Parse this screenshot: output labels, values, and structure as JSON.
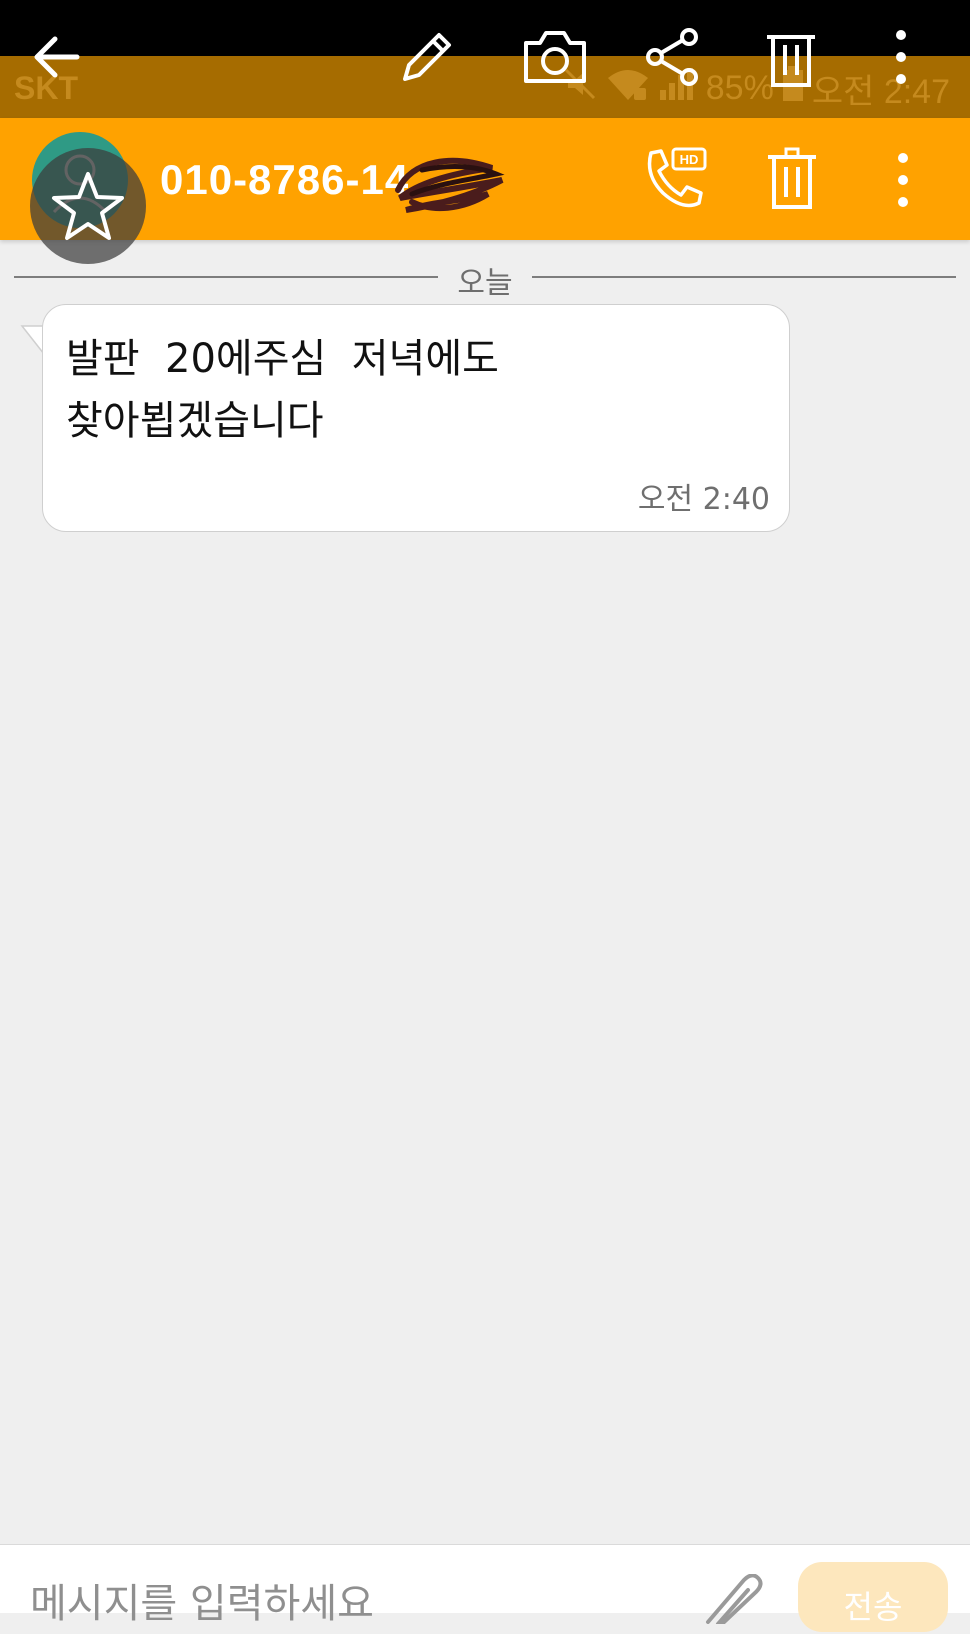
{
  "status_bar": {
    "carrier": "SKT",
    "battery": "85%",
    "time": "오전 2:47",
    "icons": [
      "mute-icon",
      "wifi-icon",
      "signal-icon",
      "battery-icon"
    ]
  },
  "edit_toolbar": {
    "icons": [
      "back-arrow-icon",
      "pencil-icon",
      "camera-icon",
      "share-icon",
      "trash-icon",
      "more-vert-icon"
    ]
  },
  "header": {
    "contact": "010-8786-14",
    "icons": [
      "avatar-icon",
      "star-icon",
      "hd-call-icon",
      "trash-icon",
      "more-vert-icon"
    ],
    "color": "#ffa200"
  },
  "divider": {
    "label": "오늘"
  },
  "messages": [
    {
      "text": "발판  20에주심  저녁에도\n찾아뵙겠습니다",
      "time": "오전 2:40"
    }
  ],
  "composer": {
    "placeholder": "메시지를 입력하세요",
    "send_label": "전송",
    "attach_icon": "paperclip-icon"
  }
}
